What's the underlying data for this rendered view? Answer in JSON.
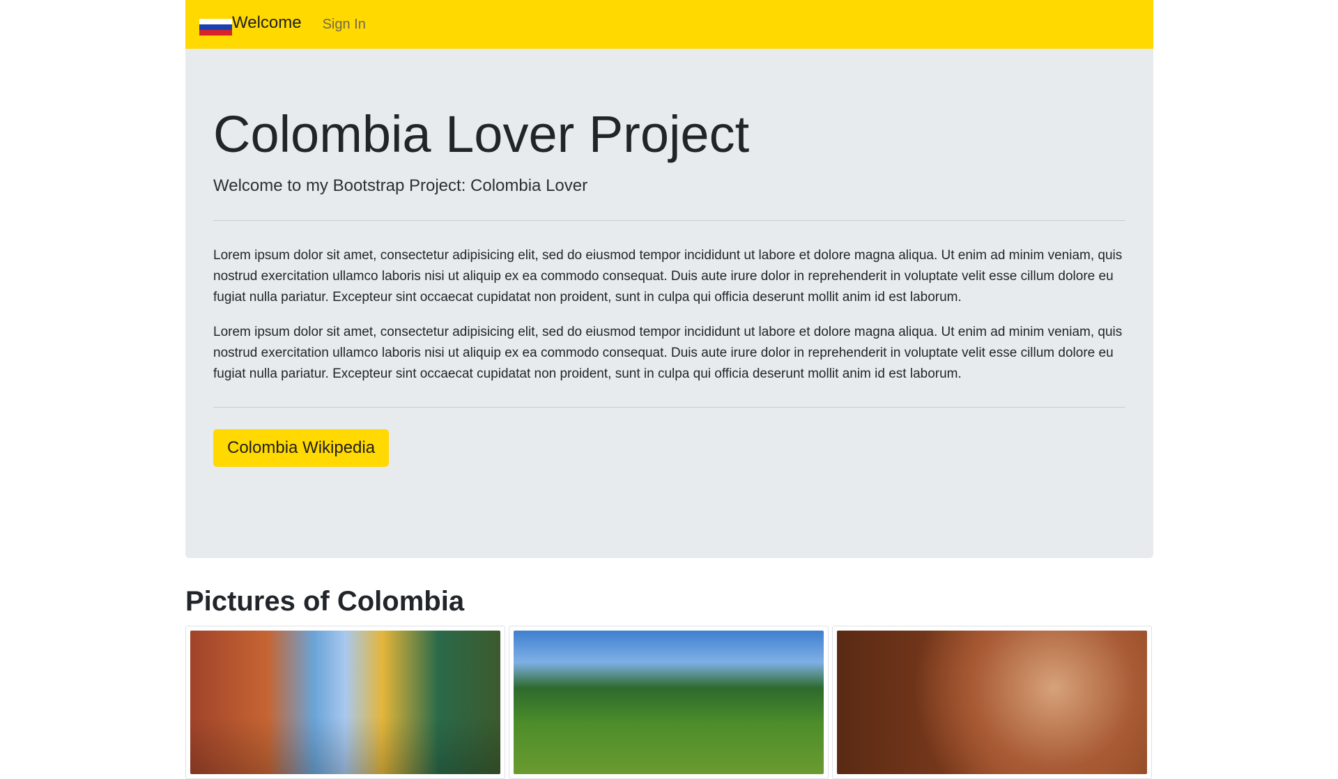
{
  "navbar": {
    "brand": "Welcome",
    "sign_in": "Sign In",
    "flag_colors": [
      "#ffffff",
      "#1c3fb0",
      "#d8232a"
    ],
    "background": "#ffd900"
  },
  "jumbotron": {
    "title": "Colombia Lover Project",
    "subtitle": "Welcome to my Bootstrap Project: Colombia Lover",
    "paragraphs": [
      "Lorem ipsum dolor sit amet, consectetur adipisicing elit, sed do eiusmod tempor incididunt ut labore et dolore magna aliqua. Ut enim ad minim veniam, quis nostrud exercitation ullamco laboris nisi ut aliquip ex ea commodo consequat. Duis aute irure dolor in reprehenderit in voluptate velit esse cillum dolore eu fugiat nulla pariatur. Excepteur sint occaecat cupidatat non proident, sunt in culpa qui officia deserunt mollit anim id est laborum.",
      "Lorem ipsum dolor sit amet, consectetur adipisicing elit, sed do eiusmod tempor incididunt ut labore et dolore magna aliqua. Ut enim ad minim veniam, quis nostrud exercitation ullamco laboris nisi ut aliquip ex ea commodo consequat. Duis aute irure dolor in reprehenderit in voluptate velit esse cillum dolore eu fugiat nulla pariatur. Excepteur sint occaecat cupidatat non proident, sunt in culpa qui officia deserunt mollit anim id est laborum."
    ],
    "button_label": "Colombia Wikipedia",
    "background": "#e8ebee"
  },
  "pictures": {
    "heading": "Pictures of Colombia",
    "images": [
      "city-street-photo",
      "hillside-person-photo",
      "cocoa-beans-photo"
    ]
  }
}
